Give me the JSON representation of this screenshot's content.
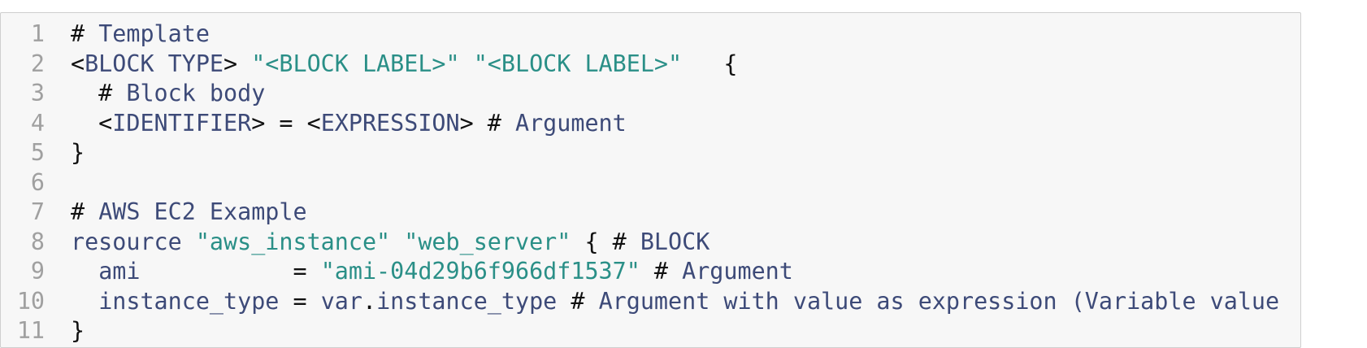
{
  "code": {
    "lines": [
      {
        "n": "1",
        "tokens": [
          {
            "t": "# ",
            "c": "p"
          },
          {
            "t": "Template",
            "c": "cmt"
          }
        ]
      },
      {
        "n": "2",
        "tokens": [
          {
            "t": "<",
            "c": "p"
          },
          {
            "t": "BLOCK TYPE",
            "c": "id"
          },
          {
            "t": "> ",
            "c": "p"
          },
          {
            "t": "\"<BLOCK LABEL>\"",
            "c": "str"
          },
          {
            "t": " ",
            "c": "p"
          },
          {
            "t": "\"<BLOCK LABEL>\"",
            "c": "str"
          },
          {
            "t": "   {",
            "c": "p"
          }
        ]
      },
      {
        "n": "3",
        "tokens": [
          {
            "t": "  # ",
            "c": "p"
          },
          {
            "t": "Block body",
            "c": "cmt"
          }
        ]
      },
      {
        "n": "4",
        "tokens": [
          {
            "t": "  <",
            "c": "p"
          },
          {
            "t": "IDENTIFIER",
            "c": "id"
          },
          {
            "t": "> = <",
            "c": "p"
          },
          {
            "t": "EXPRESSION",
            "c": "id"
          },
          {
            "t": "> # ",
            "c": "p"
          },
          {
            "t": "Argument",
            "c": "cmt"
          }
        ]
      },
      {
        "n": "5",
        "tokens": [
          {
            "t": "}",
            "c": "p"
          }
        ]
      },
      {
        "n": "6",
        "tokens": []
      },
      {
        "n": "7",
        "tokens": [
          {
            "t": "# ",
            "c": "p"
          },
          {
            "t": "AWS EC2 Example",
            "c": "cmt"
          }
        ]
      },
      {
        "n": "8",
        "tokens": [
          {
            "t": "resource ",
            "c": "kw"
          },
          {
            "t": "\"aws_instance\"",
            "c": "str"
          },
          {
            "t": " ",
            "c": "p"
          },
          {
            "t": "\"web_server\"",
            "c": "str"
          },
          {
            "t": " { # ",
            "c": "p"
          },
          {
            "t": "BLOCK",
            "c": "cmt"
          }
        ]
      },
      {
        "n": "9",
        "tokens": [
          {
            "t": "  ",
            "c": "p"
          },
          {
            "t": "ami",
            "c": "id"
          },
          {
            "t": "           = ",
            "c": "p"
          },
          {
            "t": "\"ami-04d29b6f966df1537\"",
            "c": "str"
          },
          {
            "t": " # ",
            "c": "p"
          },
          {
            "t": "Argument",
            "c": "cmt"
          }
        ]
      },
      {
        "n": "10",
        "tokens": [
          {
            "t": "  ",
            "c": "p"
          },
          {
            "t": "instance_type",
            "c": "id"
          },
          {
            "t": " = ",
            "c": "p"
          },
          {
            "t": "var",
            "c": "id"
          },
          {
            "t": ".",
            "c": "p"
          },
          {
            "t": "instance_type",
            "c": "id"
          },
          {
            "t": " # ",
            "c": "p"
          },
          {
            "t": "Argument with value as expression (Variable value",
            "c": "cmt"
          }
        ]
      },
      {
        "n": "11",
        "tokens": [
          {
            "t": "}",
            "c": "p"
          }
        ]
      }
    ]
  }
}
